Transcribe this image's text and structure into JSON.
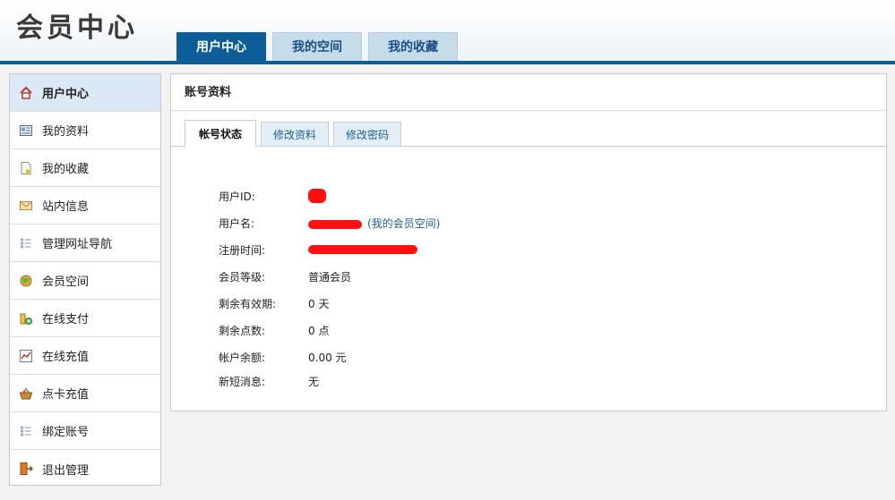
{
  "header": {
    "logo_text": "会员中心",
    "tabs": [
      {
        "label": "用户中心",
        "active": true
      },
      {
        "label": "我的空间",
        "active": false
      },
      {
        "label": "我的收藏",
        "active": false
      }
    ]
  },
  "sidebar": {
    "items": [
      {
        "label": "用户中心",
        "icon": "home-icon",
        "active": true
      },
      {
        "label": "我的资料",
        "icon": "profile-card-icon"
      },
      {
        "label": "我的收藏",
        "icon": "favorite-page-icon"
      },
      {
        "label": "站内信息",
        "icon": "mail-icon"
      },
      {
        "label": "管理网址导航",
        "icon": "list-icon"
      },
      {
        "label": "会员空间",
        "icon": "globe-icon"
      },
      {
        "label": "在线支付",
        "icon": "coins-icon"
      },
      {
        "label": "在线充值",
        "icon": "chart-icon"
      },
      {
        "label": "点卡充值",
        "icon": "basket-icon"
      },
      {
        "label": "绑定账号",
        "icon": "list-icon"
      },
      {
        "label": "退出管理",
        "icon": "exit-icon"
      }
    ]
  },
  "main": {
    "title": "账号资料",
    "sub_tabs": [
      {
        "label": "帐号状态",
        "active": true
      },
      {
        "label": "修改资料",
        "active": false
      },
      {
        "label": "修改密码",
        "active": false
      }
    ],
    "info": {
      "user_id_label": "用户ID:",
      "username_label": "用户名:",
      "my_space_link": "(我的会员空间)",
      "reg_time_label": "注册时间:",
      "level_label": "会员等级:",
      "level_value": "普通会员",
      "valid_days_label": "剩余有效期:",
      "valid_days_value": "0 天",
      "points_label": "剩余点数:",
      "points_value": "0 点",
      "balance_label": "帐户余额:",
      "balance_value": "0.00 元",
      "messages_label": "新短消息:",
      "messages_value": "无"
    }
  },
  "colors": {
    "brand_blue": "#0c5d98",
    "tab_light": "#c7dcea",
    "active_side": "#dbe9f6",
    "redaction": "#ff1111"
  }
}
